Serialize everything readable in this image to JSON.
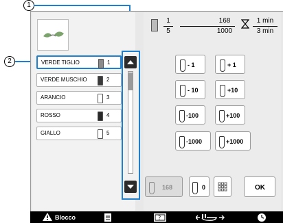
{
  "callouts": {
    "c1": "1",
    "c2": "2"
  },
  "preview": {
    "icon": "embroidery-preview"
  },
  "colors": [
    {
      "name": "VERDE TIGLIO",
      "num": "1",
      "spool_color": "#8a8a8a",
      "selected": true
    },
    {
      "name": "VERDE MUSCHIO",
      "num": "2",
      "spool_color": "#3a3a3a"
    },
    {
      "name": "ARANCIO",
      "num": "3",
      "spool_color": "#ffffff"
    },
    {
      "name": "ROSSO",
      "num": "4",
      "spool_color": "#2a2a2a"
    },
    {
      "name": "GIALLO",
      "num": "5",
      "spool_color": "#ffffff"
    }
  ],
  "progress": {
    "color_num": "1",
    "color_den": "5",
    "stitch_num": "168",
    "stitch_den": "1000",
    "time_num": "1 min",
    "time_den": "3 min"
  },
  "buttons": {
    "m1": "- 1",
    "p1": "+ 1",
    "m10": "- 10",
    "p10": "+10",
    "m100": "-100",
    "p100": "+100",
    "m1000": "-1000",
    "p1000": "+1000"
  },
  "bottom": {
    "counter_value": "168",
    "zero_label": "0",
    "ok_label": "OK",
    "blocco_label": "Blocco"
  },
  "accent": "#1f7fcf"
}
